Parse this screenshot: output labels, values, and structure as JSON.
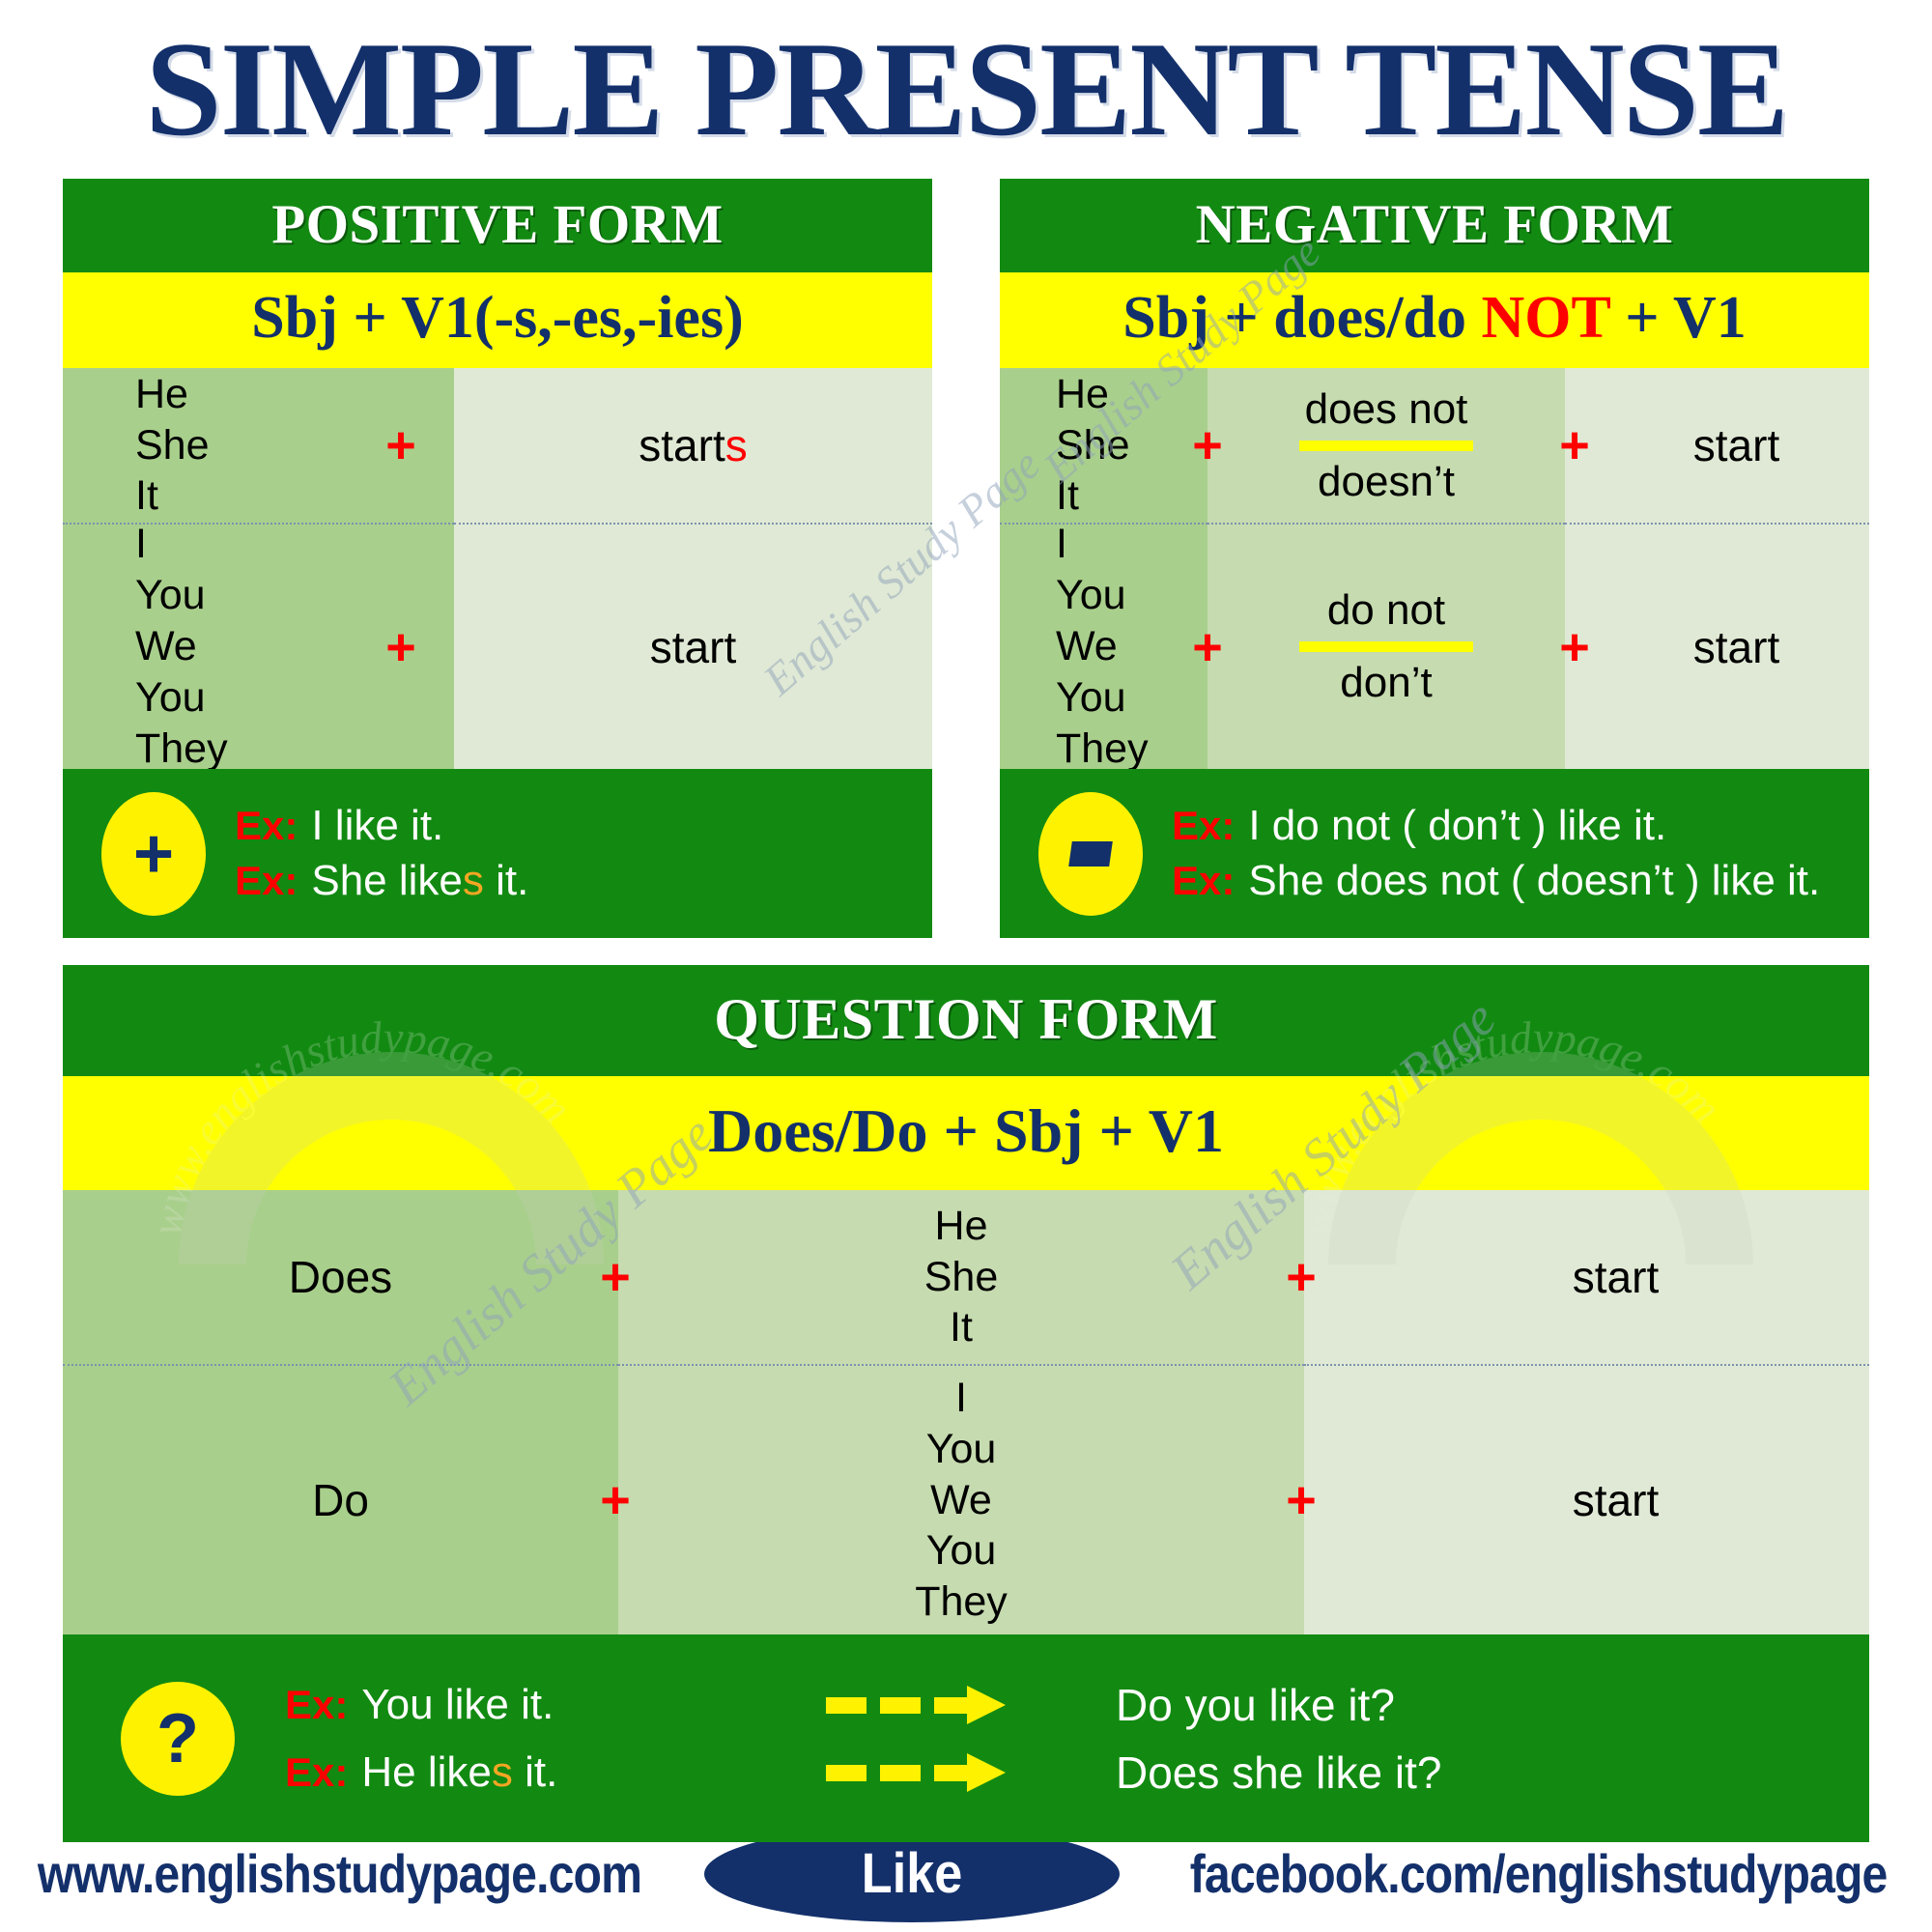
{
  "title": "SIMPLE PRESENT TENSE",
  "positive": {
    "heading": "POSITIVE FORM",
    "formula_prefix": "Sbj + V1(-s,-es,-ies)",
    "rows": [
      {
        "pronouns": "He\nShe\nIt",
        "plus": "+",
        "verb_stem": "start",
        "verb_suffix": "s"
      },
      {
        "pronouns": "I\nYou\nWe\nYou\nThey",
        "plus": "+",
        "verb_stem": "start",
        "verb_suffix": ""
      }
    ],
    "badge_symbol": "+",
    "examples": [
      {
        "tag": "Ex:",
        "text_before": "I like it.",
        "highlight": "",
        "text_after": ""
      },
      {
        "tag": "Ex:",
        "text_before": "She like",
        "highlight": "s",
        "text_after": " it."
      }
    ]
  },
  "negative": {
    "heading": "NEGATIVE FORM",
    "formula_a": "Sbj + does/do ",
    "formula_not": "NOT",
    "formula_b": " + V1",
    "rows": [
      {
        "pronouns": "He\nShe\nIt",
        "plus1": "+",
        "aux_long": "does not",
        "aux_short": "doesn’t",
        "plus2": "+",
        "verb": "start"
      },
      {
        "pronouns": "I\nYou\nWe\nYou\nThey",
        "plus1": "+",
        "aux_long": "do not",
        "aux_short": "don’t",
        "plus2": "+",
        "verb": "start"
      }
    ],
    "badge_symbol": "-",
    "examples": [
      {
        "tag": "Ex:",
        "text": "I do not ( don’t ) like it."
      },
      {
        "tag": "Ex:",
        "text": "She does not ( doesn’t ) like it."
      }
    ]
  },
  "question": {
    "heading": "QUESTION FORM",
    "formula": "Does/Do +  Sbj + V1",
    "rows": [
      {
        "aux": "Does",
        "plus1": "+",
        "pronouns": "He\nShe\nIt",
        "plus2": "+",
        "verb": "start"
      },
      {
        "aux": "Do",
        "plus1": "+",
        "pronouns": "I\nYou\nWe\nYou\nThey",
        "plus2": "+",
        "verb": "start"
      }
    ],
    "badge_symbol": "?",
    "examples": [
      {
        "tag": "Ex:",
        "source_before": "You like it.",
        "source_highlight": "",
        "source_after": "",
        "result": "Do you like it?"
      },
      {
        "tag": "Ex:",
        "source_before": "He like",
        "source_highlight": "s",
        "source_after": " it.",
        "result": "Does she like it?"
      }
    ]
  },
  "footer": {
    "website": "www.englishstudypage.com",
    "like_label": "Like",
    "facebook": "facebook.com/englishstudypage"
  },
  "watermarks": {
    "diagonal": "English Study Page",
    "ring": "www.englishstudypage.com"
  },
  "colors": {
    "navy": "#13306b",
    "green": "#128A12",
    "yellow": "#FFFF00",
    "red": "#FF0000",
    "green_dark_cell": "#a9cf8c",
    "green_mid_cell": "#c6dbaf",
    "green_light_cell": "#e0e9d5",
    "orange_suffix": "#F5A623"
  }
}
